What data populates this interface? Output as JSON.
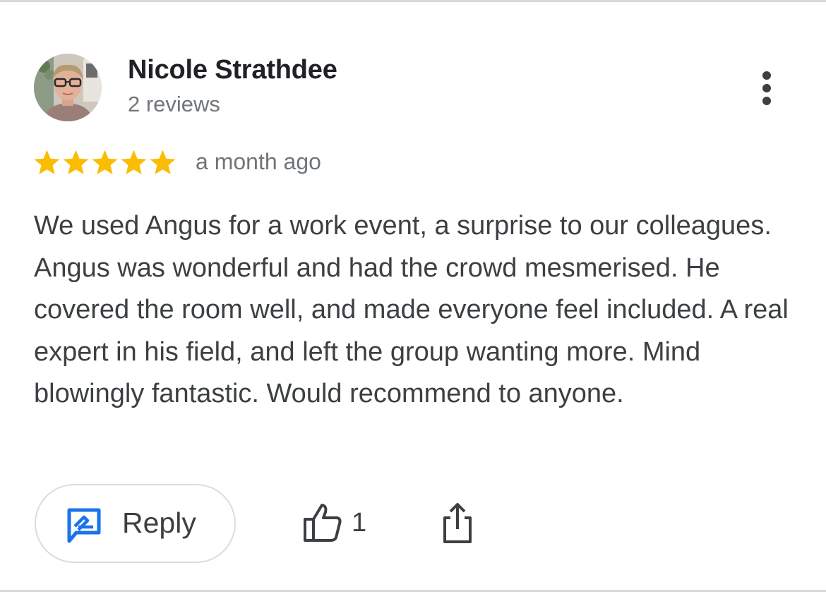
{
  "review": {
    "reviewer": {
      "name": "Nicole Strathdee",
      "review_count": "2 reviews",
      "avatar": "profile-photo"
    },
    "more_menu_icon": "vertical-ellipsis-icon",
    "rating": {
      "stars": 5,
      "max": 5,
      "color": "#fbbc04"
    },
    "date": "a month ago",
    "text": "We used Angus for a work event, a surprise to our colleagues. Angus was wonderful and had the crowd mesmerised. He covered the room well, and made everyone feel included. A real expert in his field, and left the group wanting more. Mind blowingly fantastic. Would recommend to anyone.",
    "actions": {
      "reply": {
        "label": "Reply",
        "icon": "reply-icon",
        "icon_color": "#1a73e8"
      },
      "like": {
        "count": "1",
        "icon": "thumbs-up-icon"
      },
      "share": {
        "icon": "share-icon"
      }
    }
  }
}
